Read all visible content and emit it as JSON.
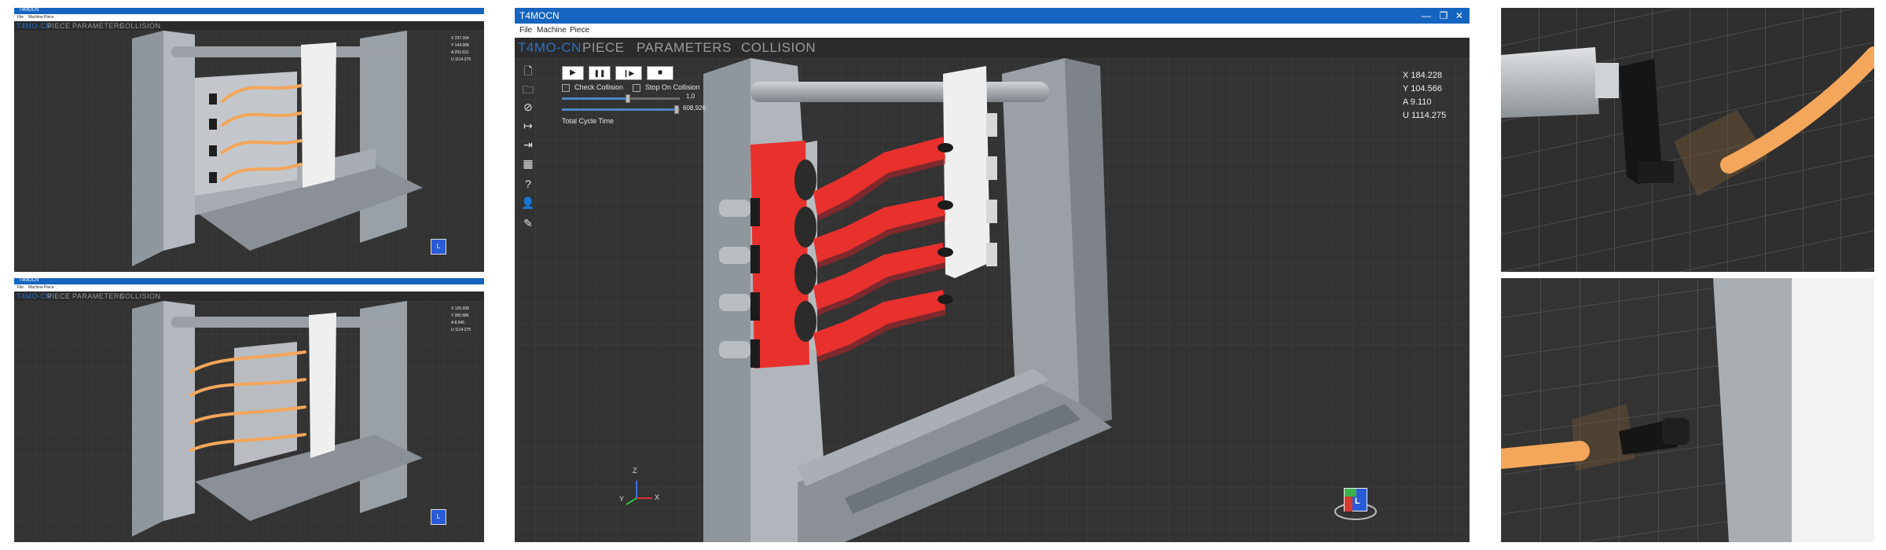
{
  "window": {
    "title": "T4MOCN",
    "controls": [
      "—",
      "❐",
      "✕"
    ]
  },
  "menu": [
    "File",
    "Machine",
    "Piece"
  ],
  "tabs": [
    {
      "label": "T4MO-CN",
      "active": true
    },
    {
      "label": "PIECE",
      "active": false
    },
    {
      "label": "PARAMETERS",
      "active": false
    },
    {
      "label": "COLLISION",
      "active": false
    }
  ],
  "sidebar_icons": [
    "new-file-icon",
    "open-folder-icon",
    "hide-icon",
    "import-icon",
    "export-icon",
    "mesh-icon",
    "help-icon",
    "user-icon",
    "pen-icon"
  ],
  "controls": {
    "play": "▶",
    "pause": "❚❚",
    "step": "❙▶",
    "stop": "■",
    "check_collision": "Check Collision",
    "stop_on_collision": "Stop On Collision",
    "speed_value": "1,0",
    "time_value": "608,926",
    "total_cycle_time": "Total Cycle Time",
    "speed_level": 0.56,
    "time_level": 0.97
  },
  "readouts": {
    "main": [
      "X 184.228",
      "Y 104.566",
      "A 9.110",
      "U 1114.275"
    ],
    "top_left": [
      "X 237.164",
      "Y 144.908",
      "A 291.631",
      "U 1114.275"
    ],
    "bottom_left": [
      "X 126.999",
      "Y 280.886",
      "A 8.946",
      "U 1114.275"
    ]
  },
  "axis_gizmo": {
    "x": "X",
    "y": "Y",
    "z": "Z"
  },
  "nav_cube": {
    "face_front": "L"
  },
  "colors": {
    "titlebar": "#1565c0",
    "active_tab": "#2f6fba",
    "tab": "#9a9a9a",
    "viewport": "#333333",
    "rail_red": "#e8302c",
    "rail_orange": "#f4a65a",
    "machine_grey": "#a7adb3",
    "comb_white": "#efefef"
  }
}
